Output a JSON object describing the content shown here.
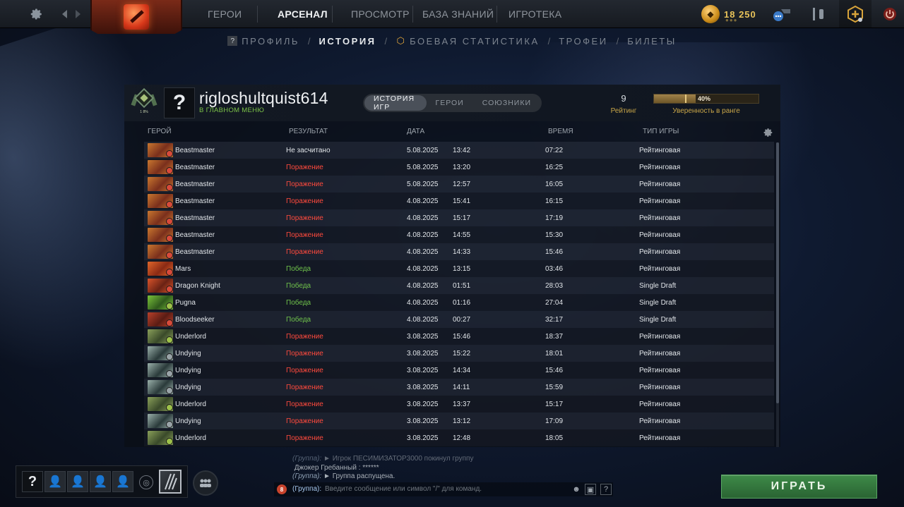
{
  "topnav": {
    "items": [
      "ГЕРОИ",
      "АРСЕНАЛ",
      "ПРОСМОТР",
      "БАЗА ЗНАНИЙ",
      "ИГРОТЕКА"
    ],
    "active": "АРСЕНАЛ",
    "currency": "18 250"
  },
  "subnav": {
    "profile": "ПРОФИЛЬ",
    "history": "ИСТОРИЯ",
    "stats": "БОЕВАЯ СТАТИСТИКА",
    "trophies": "ТРОФЕИ",
    "tickets": "БИЛЕТЫ",
    "separator": "/"
  },
  "profile": {
    "avatar_placeholder": "?",
    "username": "rigloshultquist614",
    "status": "В ГЛАВНОМ МЕНЮ",
    "medal_text": "1 8%",
    "tabs": [
      "ИСТОРИЯ ИГР",
      "ГЕРОИ",
      "СОЮЗНИКИ"
    ],
    "rating_value": "9",
    "rating_label": "Рейтинг",
    "confidence_value": 40,
    "confidence_text": "40%",
    "confidence_label": "Уверенность в ранге"
  },
  "table": {
    "columns": [
      "ГЕРОЙ",
      "РЕЗУЛЬТАТ",
      "ДАТА",
      "ВРЕМЯ",
      "ТИП ИГРЫ"
    ],
    "rows": [
      {
        "hero": "Beastmaster",
        "result": "Не засчитано",
        "kind": "none",
        "date": "5.08.2025",
        "time": "13:42",
        "duration": "07:22",
        "mode": "Рейтинговая"
      },
      {
        "hero": "Beastmaster",
        "result": "Поражение",
        "kind": "loss",
        "date": "5.08.2025",
        "time": "13:20",
        "duration": "16:25",
        "mode": "Рейтинговая"
      },
      {
        "hero": "Beastmaster",
        "result": "Поражение",
        "kind": "loss",
        "date": "5.08.2025",
        "time": "12:57",
        "duration": "16:05",
        "mode": "Рейтинговая"
      },
      {
        "hero": "Beastmaster",
        "result": "Поражение",
        "kind": "loss",
        "date": "4.08.2025",
        "time": "15:41",
        "duration": "16:15",
        "mode": "Рейтинговая"
      },
      {
        "hero": "Beastmaster",
        "result": "Поражение",
        "kind": "loss",
        "date": "4.08.2025",
        "time": "15:17",
        "duration": "17:19",
        "mode": "Рейтинговая"
      },
      {
        "hero": "Beastmaster",
        "result": "Поражение",
        "kind": "loss",
        "date": "4.08.2025",
        "time": "14:55",
        "duration": "15:30",
        "mode": "Рейтинговая"
      },
      {
        "hero": "Beastmaster",
        "result": "Поражение",
        "kind": "loss",
        "date": "4.08.2025",
        "time": "14:33",
        "duration": "15:46",
        "mode": "Рейтинговая"
      },
      {
        "hero": "Mars",
        "result": "Победа",
        "kind": "win",
        "date": "4.08.2025",
        "time": "13:15",
        "duration": "03:46",
        "mode": "Рейтинговая"
      },
      {
        "hero": "Dragon Knight",
        "result": "Победа",
        "kind": "win",
        "date": "4.08.2025",
        "time": "01:51",
        "duration": "28:03",
        "mode": "Single Draft"
      },
      {
        "hero": "Pugna",
        "result": "Победа",
        "kind": "win",
        "date": "4.08.2025",
        "time": "01:16",
        "duration": "27:04",
        "mode": "Single Draft"
      },
      {
        "hero": "Bloodseeker",
        "result": "Победа",
        "kind": "win",
        "date": "4.08.2025",
        "time": "00:27",
        "duration": "32:17",
        "mode": "Single Draft"
      },
      {
        "hero": "Underlord",
        "result": "Поражение",
        "kind": "loss",
        "date": "3.08.2025",
        "time": "15:46",
        "duration": "18:37",
        "mode": "Рейтинговая"
      },
      {
        "hero": "Undying",
        "result": "Поражение",
        "kind": "loss",
        "date": "3.08.2025",
        "time": "15:22",
        "duration": "18:01",
        "mode": "Рейтинговая"
      },
      {
        "hero": "Undying",
        "result": "Поражение",
        "kind": "loss",
        "date": "3.08.2025",
        "time": "14:34",
        "duration": "15:46",
        "mode": "Рейтинговая"
      },
      {
        "hero": "Undying",
        "result": "Поражение",
        "kind": "loss",
        "date": "3.08.2025",
        "time": "14:11",
        "duration": "15:59",
        "mode": "Рейтинговая"
      },
      {
        "hero": "Underlord",
        "result": "Поражение",
        "kind": "loss",
        "date": "3.08.2025",
        "time": "13:37",
        "duration": "15:17",
        "mode": "Рейтинговая"
      },
      {
        "hero": "Undying",
        "result": "Поражение",
        "kind": "loss",
        "date": "3.08.2025",
        "time": "13:12",
        "duration": "17:09",
        "mode": "Рейтинговая"
      },
      {
        "hero": "Underlord",
        "result": "Поражение",
        "kind": "loss",
        "date": "3.08.2025",
        "time": "12:48",
        "duration": "18:05",
        "mode": "Рейтинговая"
      }
    ]
  },
  "hero_colors": {
    "Beastmaster": [
      "#7a2f1c",
      "#c9772f",
      "#d84a3a"
    ],
    "Mars": [
      "#8a2a14",
      "#e0662a",
      "#d84a3a"
    ],
    "Dragon Knight": [
      "#6a2214",
      "#d8532a",
      "#d84a3a"
    ],
    "Pugna": [
      "#2f5a1c",
      "#7ac23a",
      "#9ec24a"
    ],
    "Bloodseeker": [
      "#5a1c14",
      "#b8402a",
      "#d84a3a"
    ],
    "Underlord": [
      "#3a4a2a",
      "#8aa05a",
      "#9ec24a"
    ],
    "Undying": [
      "#2a3a3a",
      "#9ab0aa",
      "#9aa4a8"
    ]
  },
  "chat": {
    "log_line1_channel": "(Группа):",
    "log_line1_text": "► Игрок ПЕСИМИЗАТОР3000 покинул группу",
    "log_line2_name": "Джокер Гребанный",
    "log_line2_text": ": ******",
    "log_line3_channel": "(Группа):",
    "log_line3_text": "► Группа распущена.",
    "unread_count": "8",
    "channel": "(Группа):",
    "placeholder": "Введите сообщение или символ \"/\" для команд."
  },
  "party": {
    "me_placeholder": "?"
  },
  "play_label": "ИГРАТЬ",
  "colors": {
    "loss": "#ff4a3d",
    "win": "#6fc24b",
    "accent_gold": "#c9a648",
    "play_green": "#3e8a48"
  }
}
